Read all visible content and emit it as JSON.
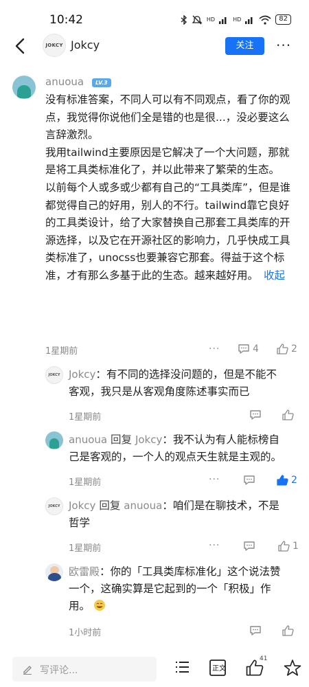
{
  "status_bar": {
    "time": "10:42",
    "signal1": "HD",
    "signal2": "HD",
    "battery": "82"
  },
  "nav": {
    "avatar_text": "JOKCY",
    "title": "Jokcy",
    "follow_label": "关注",
    "more_label": "···"
  },
  "main_comment": {
    "author": "anuoua",
    "level": "LV.3",
    "paragraphs": [
      "没有标准答案，不同人可以有不同观点，看了你的观点，我觉得你说他们全是错的也是很...，没必要这么言辞激烈。",
      "我用tailwind主要原因是它解决了一个大问题，那就是将工具类标准化了，并以此带来了繁荣的生态。",
      "以前每个人或多或少都有自己的“工具类库”，但是谁都觉得自己的好用，别人的不行。tailwind靠它良好的工具类设计，给了大家替换自己那套工具类库的开源选择，以及它在开源社区的影响力，几乎快成工具类标准了，unocss也要兼容它那套。得益于这个标准，才有那么多基于此的生态。越来越好用。"
    ],
    "collapse_label": "收起",
    "time": "1星期前",
    "more": "···",
    "comment_count": "4",
    "like_count": "2"
  },
  "replies": [
    {
      "author": "Jokcy",
      "separator": "：",
      "reply_to": "",
      "line1": "有不同的选择没问题的，但是不能不",
      "line2": "客观，我只是从客观角度陈述事实而已",
      "time": "1星期前",
      "like_count": ""
    },
    {
      "author": "anuoua",
      "reply_word": " 回复 ",
      "reply_to": "Jokcy",
      "separator": "：",
      "line1": "我不认为有人能标榜自",
      "line2": "己是客观的，一个人的观点天生就是主观的。",
      "time": "1星期前",
      "like_count": "2"
    },
    {
      "author": "Jokcy",
      "reply_word": " 回复 ",
      "reply_to": "anuoua",
      "separator": "：",
      "line1": "咱们是在聊技术，不是",
      "line2": "哲学",
      "time": "1星期前",
      "like_count": "1"
    },
    {
      "author": "欧雷殿",
      "separator": "：",
      "line1": "你的「工具类库标准化」这个说法赞",
      "line2": "一个，这确实算是它起到的一个「积极」作",
      "line3": "用。",
      "time": "1小时前",
      "like_count": ""
    }
  ],
  "bottom_bar": {
    "comment_placeholder": "写评论...",
    "like_count": "41"
  },
  "colors": {
    "accent": "#1772f6",
    "muted": "#8a8a8a"
  }
}
